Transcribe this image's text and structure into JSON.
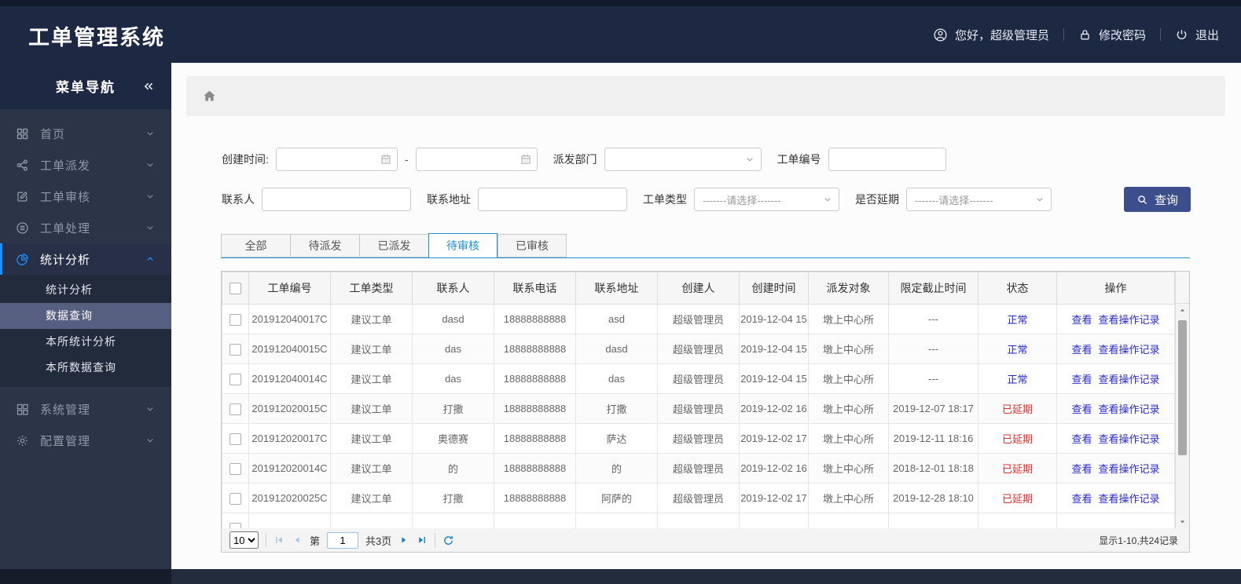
{
  "app": {
    "title": "工单管理系统"
  },
  "topbar": {
    "greeting": "您好，超级管理员",
    "change_password": "修改密码",
    "logout": "退出"
  },
  "sidebar": {
    "title": "菜单导航",
    "menu": [
      {
        "id": "home",
        "label": "首页",
        "icon": "grid-icon",
        "expanded": false,
        "active": false
      },
      {
        "id": "dispatch",
        "label": "工单派发",
        "icon": "share-icon",
        "expanded": false,
        "active": false
      },
      {
        "id": "review",
        "label": "工单审核",
        "icon": "edit-icon",
        "expanded": false,
        "active": false
      },
      {
        "id": "process",
        "label": "工单处理",
        "icon": "database-icon",
        "expanded": false,
        "active": false
      },
      {
        "id": "stats",
        "label": "统计分析",
        "icon": "pie-icon",
        "expanded": true,
        "active": true,
        "children": [
          {
            "label": "统计分析",
            "selected": false
          },
          {
            "label": "数据查询",
            "selected": true
          },
          {
            "label": "本所统计分析",
            "selected": false
          },
          {
            "label": "本所数据查询",
            "selected": false
          }
        ]
      },
      {
        "id": "system",
        "label": "系统管理",
        "icon": "grid-outline-icon",
        "expanded": false,
        "active": false
      },
      {
        "id": "config",
        "label": "配置管理",
        "icon": "gear-icon",
        "expanded": false,
        "active": false
      }
    ]
  },
  "filters": {
    "created_label": "创建时间:",
    "range_dash": "-",
    "created_from_value": "",
    "created_to_value": "",
    "dept_label": "派发部门",
    "dept_value": "",
    "order_no_label": "工单编号",
    "order_no_value": "",
    "contact_label": "联系人",
    "contact_value": "",
    "address_label": "联系地址",
    "address_value": "",
    "type_label": "工单类型",
    "type_value": "-------请选择-------",
    "delay_label": "是否延期",
    "delay_value": "-------请选择-------",
    "search_label": "查询"
  },
  "tabs": [
    {
      "label": "全部",
      "active": false
    },
    {
      "label": "待派发",
      "active": false
    },
    {
      "label": "已派发",
      "active": false
    },
    {
      "label": "待审核",
      "active": true
    },
    {
      "label": "已审核",
      "active": false
    }
  ],
  "table": {
    "columns": [
      "工单编号",
      "工单类型",
      "联系人",
      "联系电话",
      "联系地址",
      "创建人",
      "创建时间",
      "派发对象",
      "限定截止时间",
      "状态",
      "操作"
    ],
    "action_labels": [
      "查看",
      "查看操作记录"
    ],
    "rows": [
      {
        "order_no": "201912040017C",
        "type": "建议工单",
        "contact": "dasd",
        "phone": "18888888888",
        "address": "asd",
        "creator": "超级管理员",
        "created": "2019-12-04 15",
        "target": "墩上中心所",
        "deadline": "---",
        "status": "正常",
        "status_kind": "normal"
      },
      {
        "order_no": "201912040015C",
        "type": "建议工单",
        "contact": "das",
        "phone": "18888888888",
        "address": "dasd",
        "creator": "超级管理员",
        "created": "2019-12-04 15",
        "target": "墩上中心所",
        "deadline": "---",
        "status": "正常",
        "status_kind": "normal"
      },
      {
        "order_no": "201912040014C",
        "type": "建议工单",
        "contact": "das",
        "phone": "18888888888",
        "address": "das",
        "creator": "超级管理员",
        "created": "2019-12-04 15",
        "target": "墩上中心所",
        "deadline": "---",
        "status": "正常",
        "status_kind": "normal"
      },
      {
        "order_no": "201912020015C",
        "type": "建议工单",
        "contact": "打撒",
        "phone": "18888888888",
        "address": "打撒",
        "creator": "超级管理员",
        "created": "2019-12-02 16",
        "target": "墩上中心所",
        "deadline": "2019-12-07 18:17",
        "status": "已延期",
        "status_kind": "delayed"
      },
      {
        "order_no": "201912020017C",
        "type": "建议工单",
        "contact": "奥德赛",
        "phone": "18888888888",
        "address": "萨达",
        "creator": "超级管理员",
        "created": "2019-12-02 17",
        "target": "墩上中心所",
        "deadline": "2019-12-11 18:16",
        "status": "已延期",
        "status_kind": "delayed"
      },
      {
        "order_no": "201912020014C",
        "type": "建议工单",
        "contact": "的",
        "phone": "18888888888",
        "address": "的",
        "creator": "超级管理员",
        "created": "2019-12-02 16",
        "target": "墩上中心所",
        "deadline": "2018-12-01 18:18",
        "status": "已延期",
        "status_kind": "delayed"
      },
      {
        "order_no": "201912020025C",
        "type": "建议工单",
        "contact": "打撒",
        "phone": "18888888888",
        "address": "阿萨的",
        "creator": "超级管理员",
        "created": "2019-12-02 17",
        "target": "墩上中心所",
        "deadline": "2019-12-28 18:10",
        "status": "已延期",
        "status_kind": "delayed"
      }
    ],
    "has_partial_row": true
  },
  "pagination": {
    "page_size": "10",
    "page_word": "第",
    "page_value": "1",
    "total_pages": "共3页",
    "summary": "显示1-10,共24记录"
  },
  "icons": [
    "user-icon",
    "lock-icon",
    "power-icon",
    "collapse-icon",
    "grid-icon",
    "share-icon",
    "edit-icon",
    "database-icon",
    "pie-icon",
    "grid-outline-icon",
    "gear-icon",
    "chevron-down-icon",
    "chevron-up-icon",
    "home-icon",
    "calendar-icon",
    "search-icon",
    "first-page-icon",
    "prev-page-icon",
    "next-page-icon",
    "last-page-icon",
    "refresh-icon",
    "scroll-up-icon",
    "scroll-down-icon"
  ],
  "colors": {
    "header_bg": "#1d2843",
    "sidebar_bg": "#2c3547",
    "submenu_selected_bg": "#575f80",
    "accent_blue": "#1e90ff",
    "tab_active": "#1d8fd4",
    "link_blue": "#2a2ad2",
    "status_normal": "#2525cb",
    "status_delayed": "#e02b2b",
    "search_button_bg": "#3d4e8c"
  }
}
